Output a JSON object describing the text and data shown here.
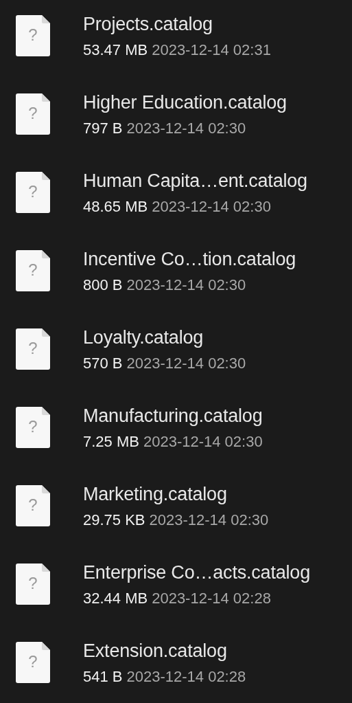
{
  "files": [
    {
      "name": "Projects.catalog",
      "size": "53.47 MB",
      "modified": "2023-12-14 02:31",
      "icon_mark": "?"
    },
    {
      "name": "Higher Education.catalog",
      "size": "797 B",
      "modified": "2023-12-14 02:30",
      "icon_mark": "?"
    },
    {
      "name": "Human Capita…ent.catalog",
      "size": "48.65 MB",
      "modified": "2023-12-14 02:30",
      "icon_mark": "?"
    },
    {
      "name": "Incentive Co…tion.catalog",
      "size": "800 B",
      "modified": "2023-12-14 02:30",
      "icon_mark": "?"
    },
    {
      "name": "Loyalty.catalog",
      "size": "570 B",
      "modified": "2023-12-14 02:30",
      "icon_mark": "?"
    },
    {
      "name": "Manufacturing.catalog",
      "size": "7.25 MB",
      "modified": "2023-12-14 02:30",
      "icon_mark": "?"
    },
    {
      "name": "Marketing.catalog",
      "size": "29.75 KB",
      "modified": "2023-12-14 02:30",
      "icon_mark": "?"
    },
    {
      "name": "Enterprise Co…acts.catalog",
      "size": "32.44 MB",
      "modified": "2023-12-14 02:28",
      "icon_mark": "?"
    },
    {
      "name": "Extension.catalog",
      "size": "541 B",
      "modified": "2023-12-14 02:28",
      "icon_mark": "?"
    }
  ]
}
